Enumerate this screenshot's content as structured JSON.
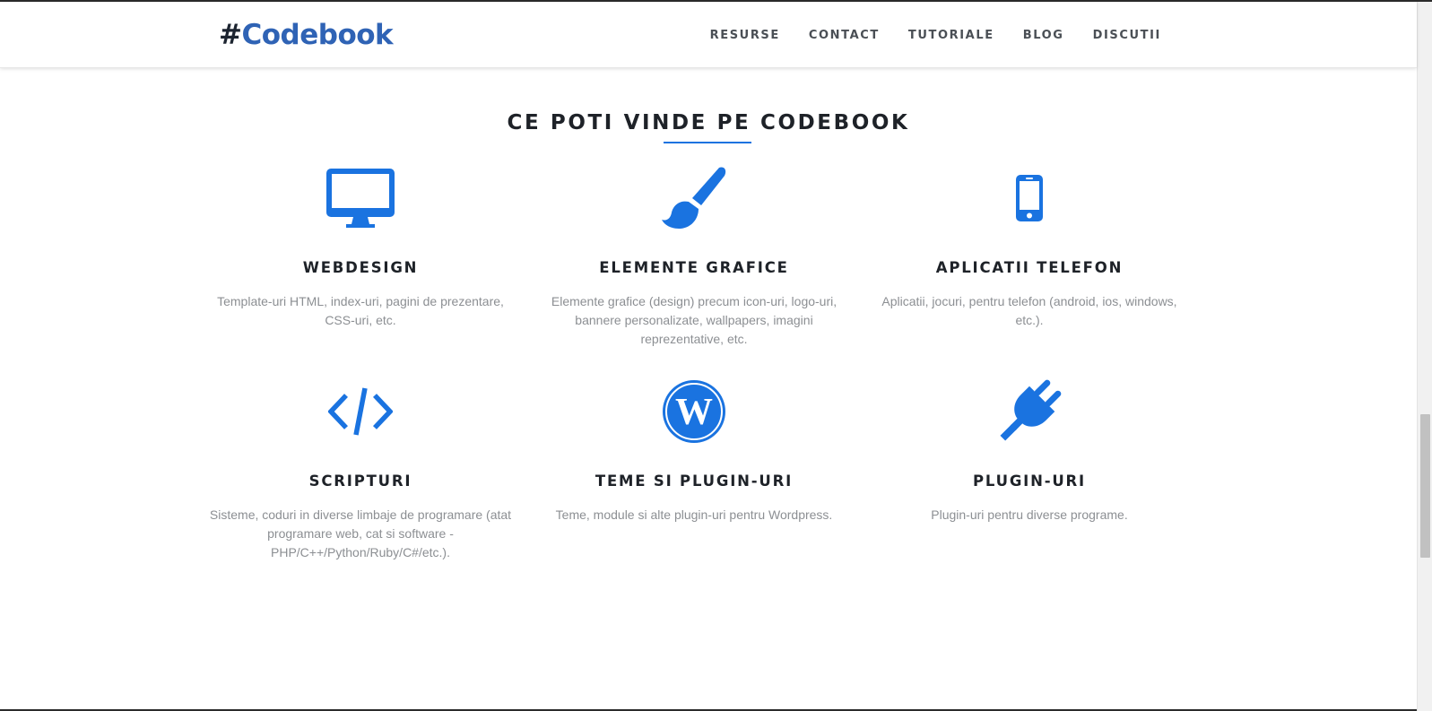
{
  "header": {
    "logo_hash": "#",
    "logo_text": "Codebook",
    "nav": [
      "RESURSE",
      "CONTACT",
      "TUTORIALE",
      "BLOG",
      "DISCUTII"
    ]
  },
  "section": {
    "title": "CE POTI VINDE PE CODEBOOK"
  },
  "services": [
    {
      "icon": "desktop-icon",
      "title": "WEBDESIGN",
      "description": "Template-uri HTML, index-uri, pagini de prezentare, CSS-uri, etc."
    },
    {
      "icon": "paintbrush-icon",
      "title": "ELEMENTE GRAFICE",
      "description": "Elemente grafice (design) precum icon-uri, logo-uri, bannere personalizate, wallpapers, imagini reprezentative, etc."
    },
    {
      "icon": "mobile-phone-icon",
      "title": "APLICATII TELEFON",
      "description": "Aplicatii, jocuri, pentru telefon (android, ios, windows, etc.)."
    },
    {
      "icon": "code-icon",
      "title": "SCRIPTURI",
      "description": "Sisteme, coduri in diverse limbaje de programare (atat programare web, cat si software - PHP/C++/Python/Ruby/C#/etc.)."
    },
    {
      "icon": "wordpress-icon",
      "title": "TEME SI PLUGIN-URI",
      "description": "Teme, module si alte plugin-uri pentru Wordpress."
    },
    {
      "icon": "plug-icon",
      "title": "PLUGIN-URI",
      "description": "Plugin-uri pentru diverse programe."
    }
  ],
  "colors": {
    "accent": "#1a73e0",
    "logo": "#2f63b5",
    "heading": "#1e2228",
    "body_text": "#8c8f93"
  }
}
